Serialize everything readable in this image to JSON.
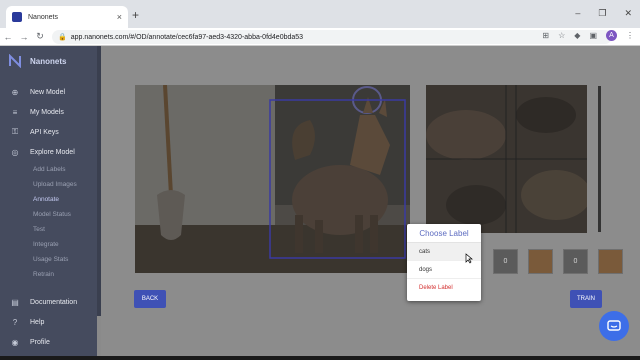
{
  "browser": {
    "tab_title": "Nanonets",
    "tab_close": "×",
    "new_tab": "+",
    "url": "app.nanonets.com/#/OD/annotate/cec6fa97-aed3-4320-abba-0fd4e0bda53",
    "window_controls": [
      "–",
      "❐",
      "✕"
    ],
    "profile_initial": "A"
  },
  "sidebar": {
    "brand": "Nanonets",
    "items": [
      {
        "label": "New Model",
        "icon": "plus-circle-icon"
      },
      {
        "label": "My Models",
        "icon": "list-icon"
      },
      {
        "label": "API Keys",
        "icon": "key-icon"
      },
      {
        "label": "Explore Model",
        "icon": "compass-icon"
      }
    ],
    "sub_items": [
      "Add Labels",
      "Upload Images",
      "Annotate",
      "Model Status",
      "Test",
      "Integrate",
      "Usage Stats",
      "Retrain"
    ],
    "active_sub": "Annotate",
    "bottom_items": [
      {
        "label": "Documentation",
        "icon": "book-icon"
      },
      {
        "label": "Help",
        "icon": "help-icon"
      },
      {
        "label": "Profile",
        "icon": "user-icon"
      }
    ]
  },
  "annotate": {
    "thumbs": [
      "0",
      "",
      "0",
      ""
    ],
    "back_label": "BACK",
    "train_label": "TRAIN"
  },
  "popup": {
    "title": "Choose Label",
    "options": [
      "cats",
      "dogs"
    ],
    "hovered": "cats",
    "delete_label": "Delete Label"
  },
  "colors": {
    "accent": "#3f51b5",
    "sidebar": "#454b5e",
    "delete": "#d32f2f"
  }
}
